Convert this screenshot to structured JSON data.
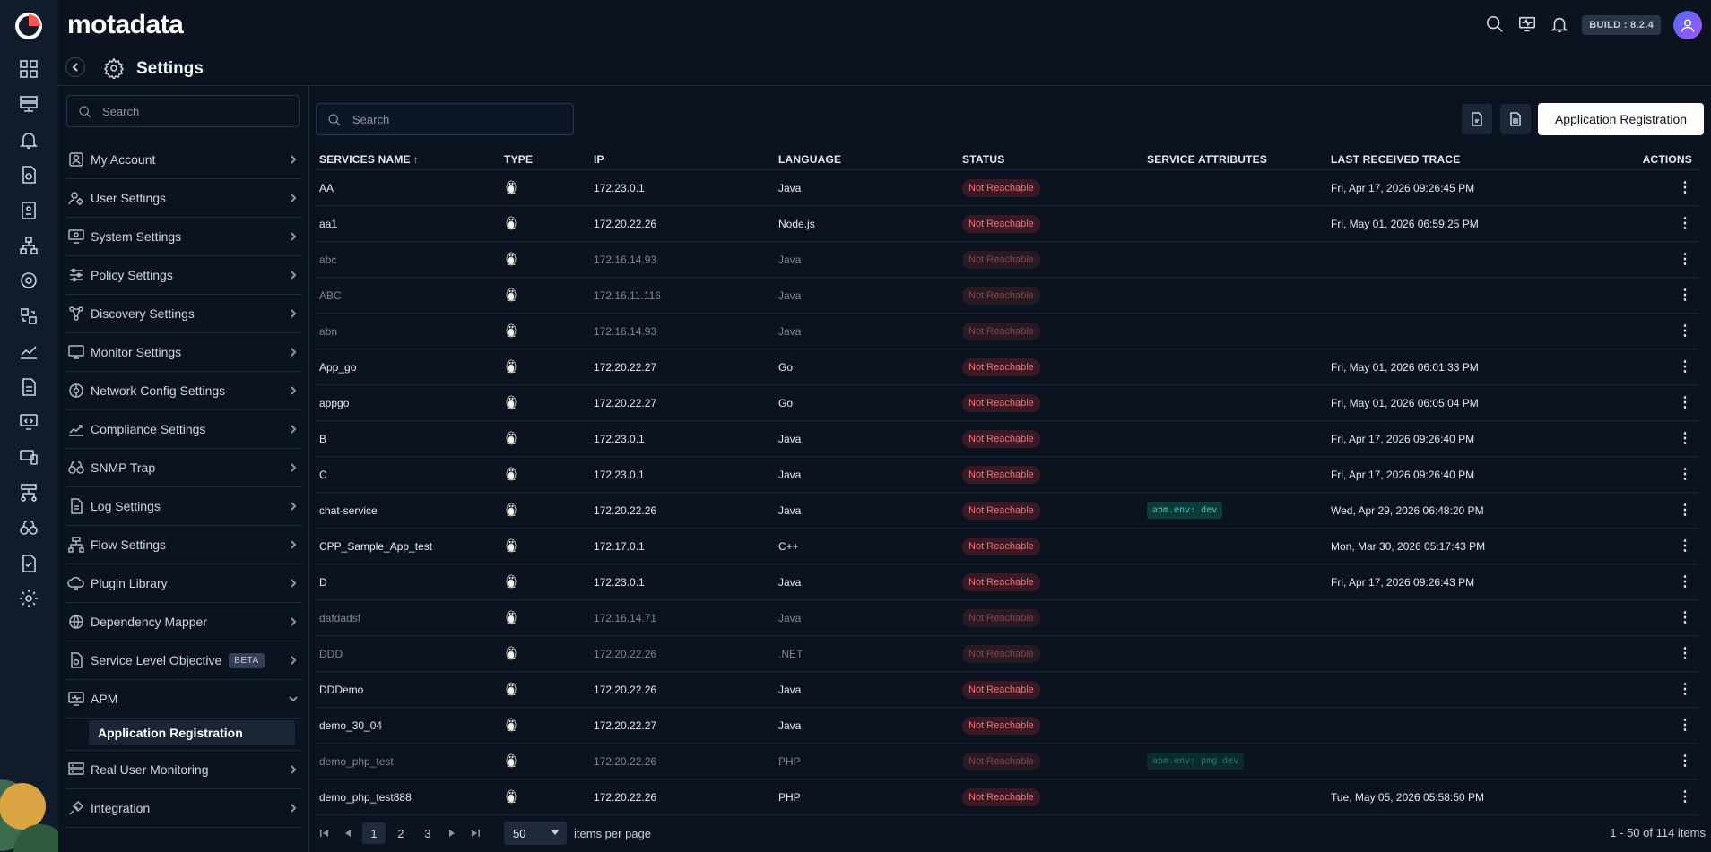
{
  "brand": "motadata",
  "build": "BUILD : 8.2.4",
  "page_title": "Settings",
  "nav": {
    "search_placeholder": "Search",
    "items": [
      {
        "label": "My Account",
        "icon": "user-card-icon"
      },
      {
        "label": "User Settings",
        "icon": "users-gear-icon"
      },
      {
        "label": "System Settings",
        "icon": "system-gear-icon"
      },
      {
        "label": "Policy Settings",
        "icon": "sliders-icon"
      },
      {
        "label": "Discovery Settings",
        "icon": "network-nodes-icon"
      },
      {
        "label": "Monitor Settings",
        "icon": "monitor-icon"
      },
      {
        "label": "Network Config Settings",
        "icon": "network-config-icon"
      },
      {
        "label": "Compliance Settings",
        "icon": "compliance-chart-icon"
      },
      {
        "label": "SNMP Trap",
        "icon": "binoculars-icon"
      },
      {
        "label": "Log Settings",
        "icon": "log-file-icon"
      },
      {
        "label": "Flow Settings",
        "icon": "flow-tree-icon"
      },
      {
        "label": "Plugin Library",
        "icon": "cloud-plugin-icon"
      },
      {
        "label": "Dependency Mapper",
        "icon": "dependency-globe-icon"
      },
      {
        "label": "Service Level Objective",
        "icon": "slo-file-icon",
        "badge": "BETA"
      },
      {
        "label": "APM",
        "icon": "apm-monitor-icon",
        "expanded": true
      }
    ],
    "apm_sub": "Application Registration",
    "after": [
      {
        "label": "Real User Monitoring",
        "icon": "rum-server-icon"
      },
      {
        "label": "Integration",
        "icon": "integration-plug-icon"
      }
    ]
  },
  "main": {
    "search_placeholder": "Search",
    "register_button": "Application Registration",
    "columns": [
      "SERVICES NAME",
      "TYPE",
      "IP",
      "LANGUAGE",
      "STATUS",
      "SERVICE ATTRIBUTES",
      "LAST RECEIVED TRACE",
      "ACTIONS"
    ],
    "rows": [
      {
        "name": "AA",
        "ip": "172.23.0.1",
        "lang": "Java",
        "status": "Not Reachable",
        "attr": "",
        "trace": "Fri, Apr 17, 2026 09:26:45 PM",
        "dim": false
      },
      {
        "name": "aa1",
        "ip": "172.20.22.26",
        "lang": "Node.js",
        "status": "Not Reachable",
        "attr": "",
        "trace": "Fri, May 01, 2026 06:59:25 PM",
        "dim": false
      },
      {
        "name": "abc",
        "ip": "172.16.14.93",
        "lang": "Java",
        "status": "Not Reachable",
        "attr": "",
        "trace": "",
        "dim": true
      },
      {
        "name": "ABC",
        "ip": "172.16.11.116",
        "lang": "Java",
        "status": "Not Reachable",
        "attr": "",
        "trace": "",
        "dim": true
      },
      {
        "name": "abn",
        "ip": "172.16.14.93",
        "lang": "Java",
        "status": "Not Reachable",
        "attr": "",
        "trace": "",
        "dim": true
      },
      {
        "name": "App_go",
        "ip": "172.20.22.27",
        "lang": "Go",
        "status": "Not Reachable",
        "attr": "",
        "trace": "Fri, May 01, 2026 06:01:33 PM",
        "dim": false
      },
      {
        "name": "appgo",
        "ip": "172.20.22.27",
        "lang": "Go",
        "status": "Not Reachable",
        "attr": "",
        "trace": "Fri, May 01, 2026 06:05:04 PM",
        "dim": false
      },
      {
        "name": "B",
        "ip": "172.23.0.1",
        "lang": "Java",
        "status": "Not Reachable",
        "attr": "",
        "trace": "Fri, Apr 17, 2026 09:26:40 PM",
        "dim": false
      },
      {
        "name": "C",
        "ip": "172.23.0.1",
        "lang": "Java",
        "status": "Not Reachable",
        "attr": "",
        "trace": "Fri, Apr 17, 2026 09:26:40 PM",
        "dim": false
      },
      {
        "name": "chat-service",
        "ip": "172.20.22.26",
        "lang": "Java",
        "status": "Not Reachable",
        "attr": "apm.env: dev",
        "trace": "Wed, Apr 29, 2026 06:48:20 PM",
        "dim": false
      },
      {
        "name": "CPP_Sample_App_test",
        "ip": "172.17.0.1",
        "lang": "C++",
        "status": "Not Reachable",
        "attr": "",
        "trace": "Mon, Mar 30, 2026 05:17:43 PM",
        "dim": false
      },
      {
        "name": "D",
        "ip": "172.23.0.1",
        "lang": "Java",
        "status": "Not Reachable",
        "attr": "",
        "trace": "Fri, Apr 17, 2026 09:26:43 PM",
        "dim": false
      },
      {
        "name": "dafdadsf",
        "ip": "172.16.14.71",
        "lang": "Java",
        "status": "Not Reachable",
        "attr": "",
        "trace": "",
        "dim": true
      },
      {
        "name": "DDD",
        "ip": "172.20.22.26",
        "lang": ".NET",
        "status": "Not Reachable",
        "attr": "",
        "trace": "",
        "dim": true
      },
      {
        "name": "DDDemo",
        "ip": "172.20.22.26",
        "lang": "Java",
        "status": "Not Reachable",
        "attr": "",
        "trace": "",
        "dim": false
      },
      {
        "name": "demo_30_04",
        "ip": "172.20.22.27",
        "lang": "Java",
        "status": "Not Reachable",
        "attr": "",
        "trace": "",
        "dim": false
      },
      {
        "name": "demo_php_test",
        "ip": "172.20.22.26",
        "lang": "PHP",
        "status": "Not Reachable",
        "attr": "apm.env: pmg.dev",
        "trace": "",
        "dim": true
      },
      {
        "name": "demo_php_test888",
        "ip": "172.20.22.26",
        "lang": "PHP",
        "status": "Not Reachable",
        "attr": "",
        "trace": "Tue, May 05, 2026 05:58:50 PM",
        "dim": false
      }
    ]
  },
  "pager": {
    "pages": [
      "1",
      "2",
      "3"
    ],
    "current": "1",
    "per_page": "50",
    "per_page_label": "items per page",
    "summary": "1 - 50 of 114 items"
  }
}
